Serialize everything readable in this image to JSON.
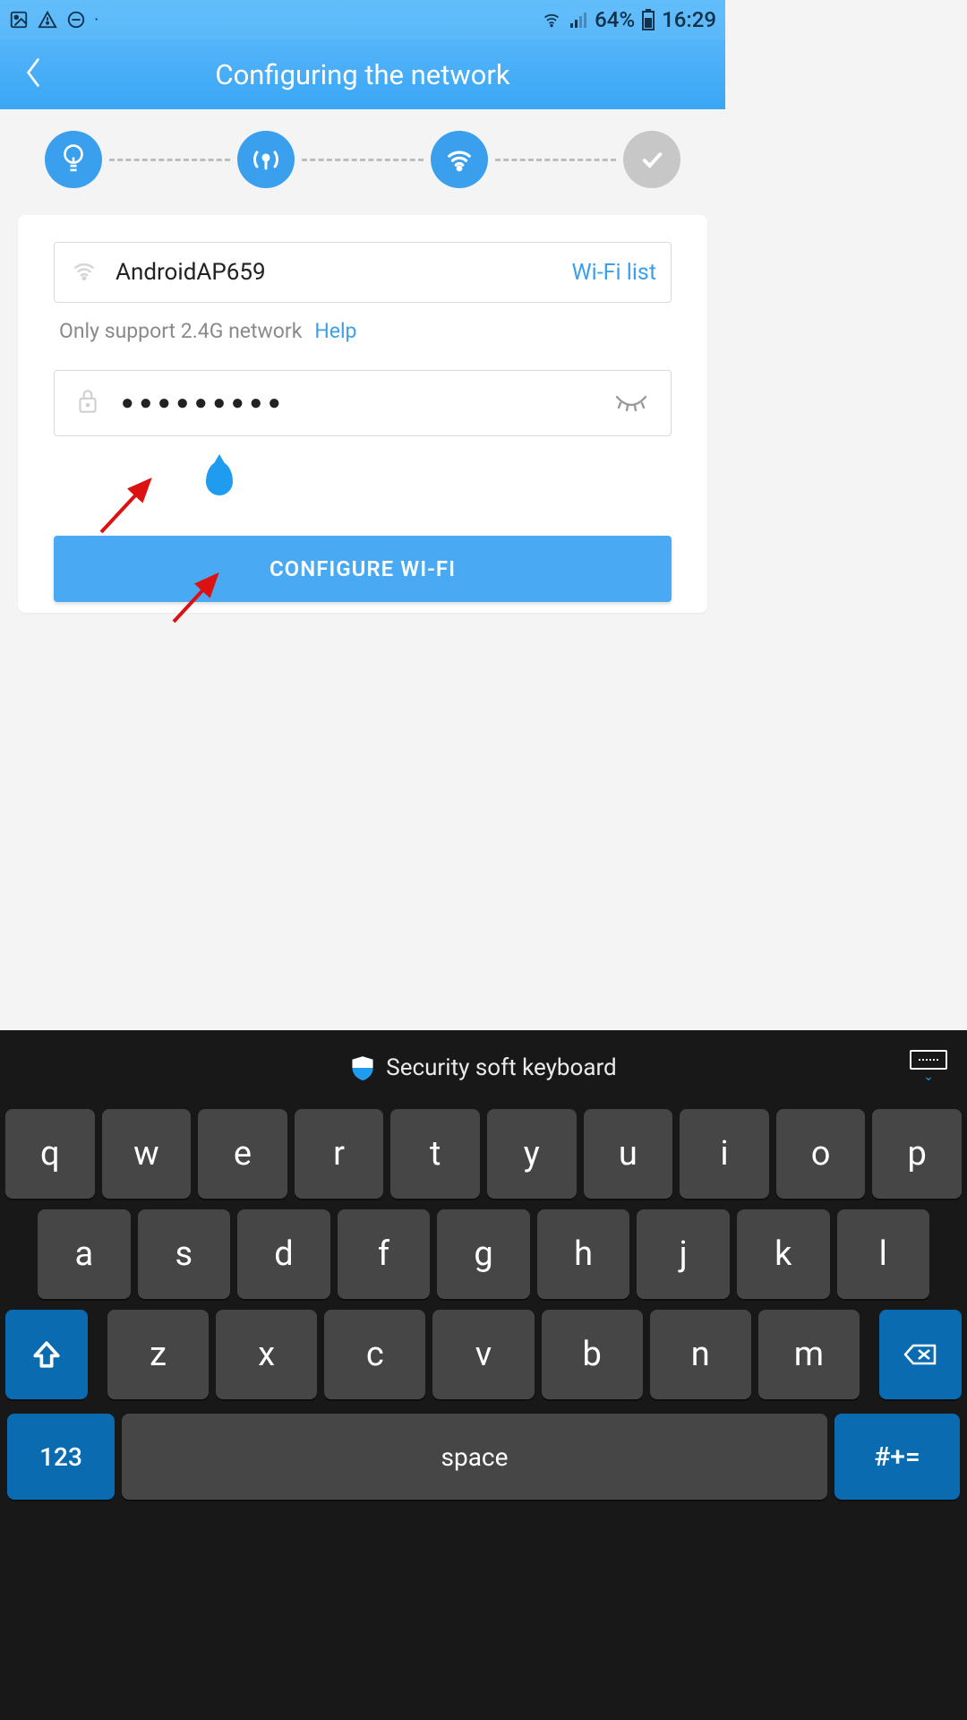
{
  "status_bar": {
    "battery_pct": "64%",
    "time": "16:29"
  },
  "header": {
    "title": "Configuring the network"
  },
  "form": {
    "ssid": "AndroidAP659",
    "wifi_list_label": "Wi-Fi list",
    "hint": "Only support 2.4G network",
    "help_label": "Help",
    "password_mask": "●●●●●●●●●",
    "configure_label": "CONFIGURE WI-FI"
  },
  "keyboard": {
    "header_label": "Security soft keyboard",
    "row1": [
      "q",
      "w",
      "e",
      "r",
      "t",
      "y",
      "u",
      "i",
      "o",
      "p"
    ],
    "row2": [
      "a",
      "s",
      "d",
      "f",
      "g",
      "h",
      "j",
      "k",
      "l"
    ],
    "row3": [
      "z",
      "x",
      "c",
      "v",
      "b",
      "n",
      "m"
    ],
    "key_123": "123",
    "key_space": "space",
    "key_sym": "#+="
  }
}
